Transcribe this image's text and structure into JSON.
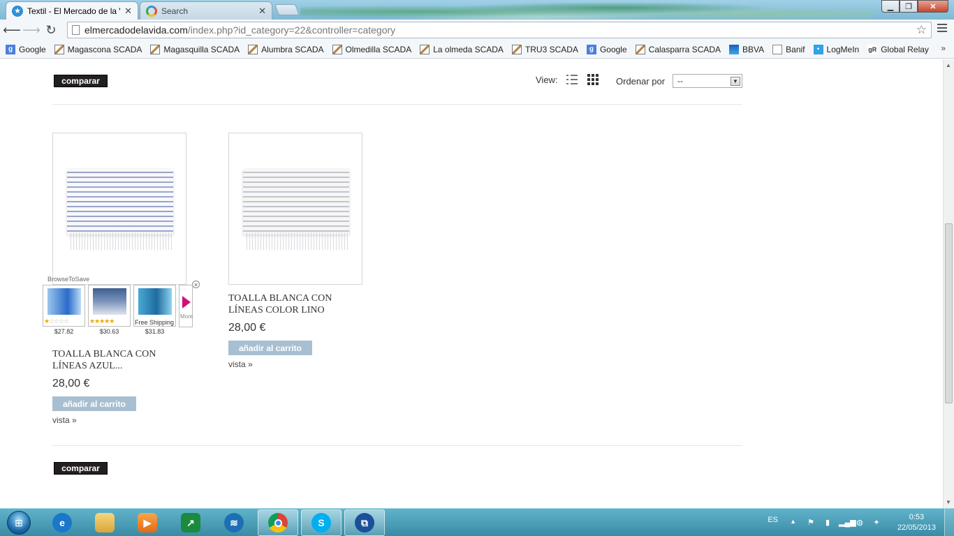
{
  "browser": {
    "tabs": [
      {
        "title": "Textil - El Mercado de la V",
        "active": true
      },
      {
        "title": "Search",
        "active": false
      }
    ],
    "url": {
      "host": "elmercadodelavida.com",
      "path": "/index.php?id_category=22&controller=category"
    },
    "bookmarks": [
      {
        "label": "Google",
        "icon": "google-icon"
      },
      {
        "label": "Magascona SCADA",
        "icon": "scada-icon"
      },
      {
        "label": "Magasquilla SCADA",
        "icon": "scada-icon"
      },
      {
        "label": "Alumbra SCADA",
        "icon": "scada-icon"
      },
      {
        "label": "Olmedilla SCADA",
        "icon": "scada-icon"
      },
      {
        "label": "La olmeda SCADA",
        "icon": "scada-icon"
      },
      {
        "label": "TRU3 SCADA",
        "icon": "scada-icon"
      },
      {
        "label": "Google",
        "icon": "google-icon"
      },
      {
        "label": "Calasparra SCADA",
        "icon": "scada-icon"
      },
      {
        "label": "BBVA",
        "icon": "bbva-icon"
      },
      {
        "label": "Banif",
        "icon": "document-icon"
      },
      {
        "label": "LogMeIn",
        "icon": "logmein-icon"
      },
      {
        "label": "Global Relay",
        "icon": "globalrelay-icon"
      }
    ],
    "bookmarks_more": "»"
  },
  "page": {
    "compare_label": "comparar",
    "view_label": "View:",
    "sort_label": "Ordenar por",
    "sort_value": "--",
    "products": [
      {
        "name_line1": "TOALLA BLANCA CON",
        "name_line2": "LÍNEAS AZUL...",
        "price": "28,00 €",
        "cart_label": "añadir al carrito",
        "view_label": "vista »"
      },
      {
        "name_line1": "TOALLA BLANCA CON",
        "name_line2": "LÍNEAS COLOR LINO",
        "price": "28,00 €",
        "cart_label": "añadir al carrito",
        "view_label": "vista »"
      }
    ]
  },
  "browsetosave": {
    "title": "BrowseToSave",
    "close": "×",
    "items": [
      {
        "price": "$27.82",
        "stars": 1
      },
      {
        "price": "$30.63",
        "stars": 5
      },
      {
        "price": "$31.83",
        "note": "Free Shipping"
      }
    ],
    "more_label": "More"
  },
  "taskbar": {
    "apps": [
      "internet-explorer",
      "windows-explorer",
      "media-player",
      "stock-app",
      "wireless-app",
      "chrome",
      "skype",
      "remote-desktop"
    ],
    "language": "ES",
    "time": "0:53",
    "date": "22/05/2013"
  }
}
